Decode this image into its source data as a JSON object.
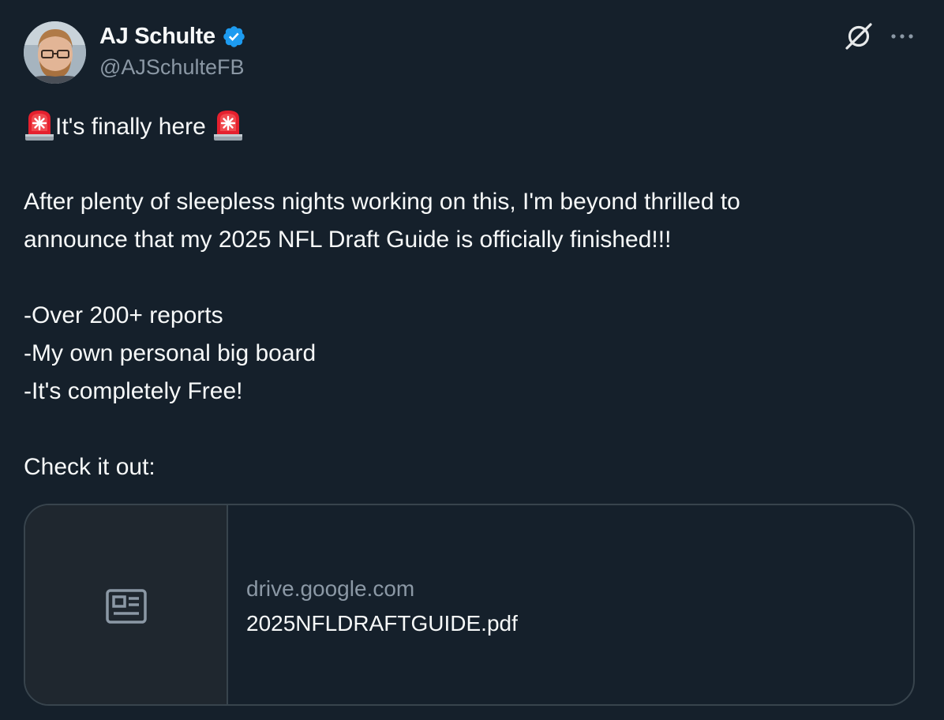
{
  "author": {
    "name": "AJ Schulte",
    "handle": "@AJSchulteFB",
    "verified": true
  },
  "icons": {
    "avatar": "profile-photo",
    "verified": "verified-badge-icon",
    "grok": "grok-icon",
    "more": "more-options-icon",
    "siren": "police-car-light-emoji",
    "card": "article-icon"
  },
  "colors": {
    "background": "#15202b",
    "text": "#f7f9f9",
    "secondary": "#8b98a5",
    "verified": "#1d9bf0",
    "border": "#38444d"
  },
  "tweet": {
    "headline": "It's finally here",
    "paragraph_line1": "After plenty of sleepless nights working on this, I'm beyond thrilled to",
    "paragraph_line2": "announce that my 2025 NFL Draft Guide is officially finished!!!",
    "bullets": [
      "-Over 200+ reports",
      "-My own personal big board",
      "-It's completely Free!"
    ],
    "cta": "Check it out:"
  },
  "link_card": {
    "domain": "drive.google.com",
    "title": "2025NFLDRAFTGUIDE.pdf"
  }
}
